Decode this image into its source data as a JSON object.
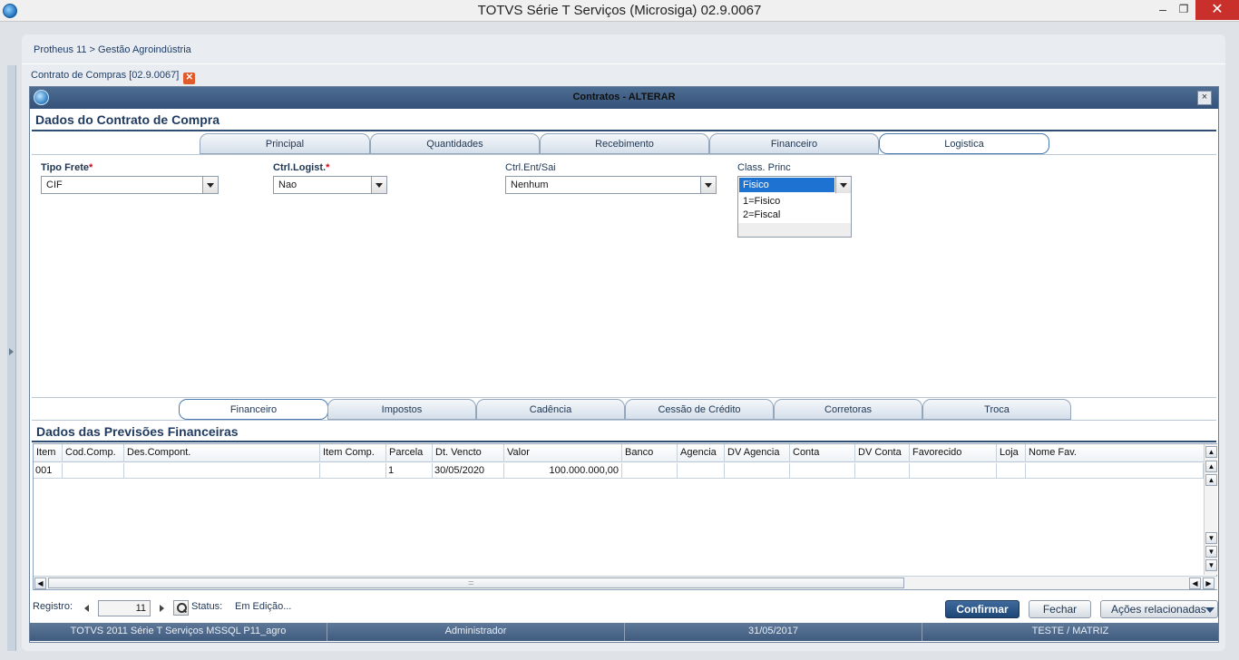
{
  "window": {
    "title": "TOTVS Série T Serviços (Microsiga) 02.9.0067",
    "minimize": "–",
    "maximize": "❐",
    "close": "✕"
  },
  "breadcrumb": "Protheus 11 > Gestão Agroindústria",
  "document_tab": {
    "label": "Contrato de Compras [02.9.0067]",
    "close": "✕"
  },
  "dialog": {
    "title": "Contratos - ALTERAR",
    "close": "×",
    "section1_title": "Dados do Contrato de Compra",
    "tabs1": [
      {
        "label": "Principal",
        "active": false
      },
      {
        "label": "Quantidades",
        "active": false
      },
      {
        "label": "Recebimento",
        "active": false
      },
      {
        "label": "Financeiro",
        "active": false
      },
      {
        "label": "Logistica",
        "active": true
      }
    ],
    "fields": {
      "tipo_frete": {
        "label": "Tipo Frete",
        "required_mark": "*",
        "value": "CIF"
      },
      "ctrl_logist": {
        "label": "Ctrl.Logist.",
        "required_mark": "*",
        "value": "Nao"
      },
      "ctrl_ent_sai": {
        "label": "Ctrl.Ent/Sai",
        "value": "Nenhum"
      },
      "class_princ": {
        "label": "Class. Princ",
        "value": "Fisico",
        "options": [
          "1=Fisico",
          "2=Fiscal"
        ]
      }
    },
    "tabs2": [
      {
        "label": "Financeiro",
        "active": true
      },
      {
        "label": "Impostos",
        "active": false
      },
      {
        "label": "Cadência",
        "active": false
      },
      {
        "label": "Cessão de Crédito",
        "active": false
      },
      {
        "label": "Corretoras",
        "active": false
      },
      {
        "label": "Troca",
        "active": false
      }
    ],
    "section2_title": "Dados das Previsões Financeiras",
    "grid": {
      "columns": [
        "Item",
        "Cod.Comp.",
        "Des.Compont.",
        "Item Comp.",
        "Parcela",
        "Dt. Vencto",
        "Valor",
        "Banco",
        "Agencia",
        "DV Agencia",
        "Conta",
        "DV Conta",
        "Favorecido",
        "Loja",
        "Nome Fav."
      ],
      "rows": [
        [
          "001",
          "",
          "",
          "",
          "1",
          "30/05/2020",
          "100.000.000,00",
          "",
          "",
          "",
          "",
          "",
          "",
          "",
          ""
        ]
      ]
    },
    "footer": {
      "registro_label": "Registro:",
      "registro_value": "11",
      "status_label": "Status:",
      "status_value": "Em Edição...",
      "confirm": "Confirmar",
      "close": "Fechar",
      "actions": "Ações relacionadas"
    },
    "statusbar": [
      "TOTVS 2011 Série T Serviços MSSQL P11_agro",
      "Administrador",
      "31/05/2017",
      "TESTE / MATRIZ"
    ]
  },
  "colors": {
    "accent": "#2d4d74",
    "selection": "#1e72d1",
    "confirm_button": "#1d4675",
    "required": "#d0021b"
  }
}
